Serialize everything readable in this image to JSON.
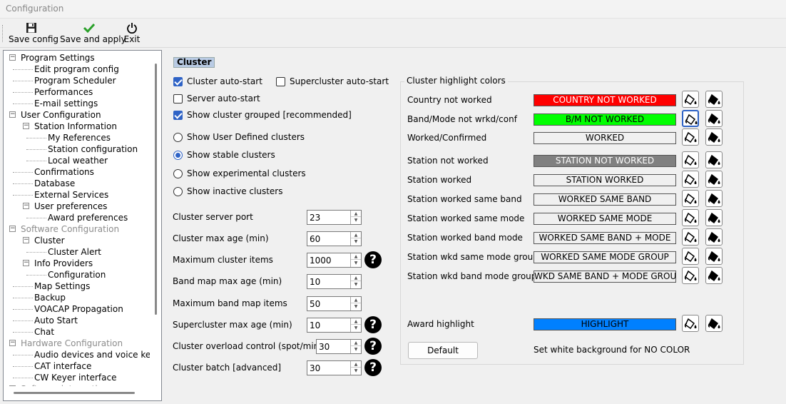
{
  "window": {
    "title": "Configuration"
  },
  "toolbar": {
    "save_config": "Save config",
    "save_apply": "Save and apply",
    "exit": "Exit"
  },
  "tree": [
    {
      "label": "Program Settings",
      "level": 0,
      "expander": "⊟",
      "disabled": false
    },
    {
      "label": "Edit program config",
      "level": 1
    },
    {
      "label": "Program Scheduler",
      "level": 1
    },
    {
      "label": "Performances",
      "level": 1
    },
    {
      "label": "E-mail settings",
      "level": 1
    },
    {
      "label": "User Configuration",
      "level": 0,
      "expander": "⊟"
    },
    {
      "label": "Station Information",
      "level": 1,
      "expander": "⊟"
    },
    {
      "label": "My References",
      "level": 2
    },
    {
      "label": "Station configuration",
      "level": 2
    },
    {
      "label": "Local weather",
      "level": 2
    },
    {
      "label": "Confirmations",
      "level": 1
    },
    {
      "label": "Database",
      "level": 1
    },
    {
      "label": "External Services",
      "level": 1
    },
    {
      "label": "User preferences",
      "level": 1,
      "expander": "⊟"
    },
    {
      "label": "Award preferences",
      "level": 2
    },
    {
      "label": "Software Configuration",
      "level": 0,
      "expander": "⊟",
      "disabled": true
    },
    {
      "label": "Cluster",
      "level": 1,
      "expander": "⊟"
    },
    {
      "label": "Cluster Alert",
      "level": 2
    },
    {
      "label": "Info Providers",
      "level": 1,
      "expander": "⊟"
    },
    {
      "label": "Configuration",
      "level": 2
    },
    {
      "label": "Map Settings",
      "level": 1
    },
    {
      "label": "Backup",
      "level": 1
    },
    {
      "label": "VOACAP Propagation",
      "level": 1
    },
    {
      "label": "Auto Start",
      "level": 1
    },
    {
      "label": "Chat",
      "level": 1
    },
    {
      "label": "Hardware Configuration",
      "level": 0,
      "expander": "⊟",
      "disabled": true
    },
    {
      "label": "Audio devices and voice keye",
      "level": 1
    },
    {
      "label": "CAT interface",
      "level": 1
    },
    {
      "label": "CW Keyer interface",
      "level": 1
    },
    {
      "label": "Software integration",
      "level": 0,
      "expander": "⊟",
      "disabled": true
    }
  ],
  "section_title": "Cluster",
  "checkboxes": {
    "cluster_autostart": {
      "label": "Cluster auto-start",
      "checked": true
    },
    "supercluster_autostart": {
      "label": "Supercluster auto-start",
      "checked": false
    },
    "server_autostart": {
      "label": "Server auto-start",
      "checked": false
    },
    "show_grouped": {
      "label": "Show cluster grouped [recommended]",
      "checked": true
    }
  },
  "radios": [
    {
      "label": "Show User Defined clusters",
      "selected": false
    },
    {
      "label": "Show stable clusters",
      "selected": true
    },
    {
      "label": "Show experimental clusters",
      "selected": false
    },
    {
      "label": "Show inactive clusters",
      "selected": false
    }
  ],
  "fields": [
    {
      "label": "Cluster server port",
      "value": "23",
      "help": false
    },
    {
      "label": "Cluster max age (min)",
      "value": "60",
      "help": false
    },
    {
      "label": "Maximum cluster items",
      "value": "1000",
      "help": true
    },
    {
      "label": "Band map max age (min)",
      "value": "10",
      "help": false
    },
    {
      "label": "Maximum band map items",
      "value": "50",
      "help": false
    },
    {
      "label": "Supercluster max age (min)",
      "value": "10",
      "help": true
    },
    {
      "label": "Cluster overload control (spot/min)",
      "value": "30",
      "help": true
    },
    {
      "label": "Cluster batch [advanced]",
      "value": "30",
      "help": true
    }
  ],
  "highlight": {
    "group_title": "Cluster highlight colors",
    "rows": [
      {
        "label": "Country not worked",
        "swatch": "COUNTRY NOT WORKED",
        "bg": "#ff0000",
        "fg": "#ffffff"
      },
      {
        "label": "Band/Mode not wrkd/conf",
        "swatch": "B/M NOT WORKED",
        "bg": "#00ff00",
        "fg": "#000000"
      },
      {
        "label": "Worked/Confirmed",
        "swatch": "WORKED",
        "bg": "#f0f0f0",
        "fg": "#000000"
      },
      {
        "label": "Station not worked",
        "swatch": "STATION NOT WORKED",
        "bg": "#808080",
        "fg": "#ffffff"
      },
      {
        "label": "Station worked",
        "swatch": "STATION WORKED",
        "bg": "#f0f0f0",
        "fg": "#000000"
      },
      {
        "label": "Station worked same band",
        "swatch": "WORKED SAME BAND",
        "bg": "#f0f0f0",
        "fg": "#000000"
      },
      {
        "label": "Station worked same mode",
        "swatch": "WORKED SAME MODE",
        "bg": "#f0f0f0",
        "fg": "#000000"
      },
      {
        "label": "Station worked band mode",
        "swatch": "WORKED SAME BAND + MODE",
        "bg": "#f0f0f0",
        "fg": "#000000"
      },
      {
        "label": "Station wkd same mode group",
        "swatch": "WORKED SAME MODE GROUP",
        "bg": "#f0f0f0",
        "fg": "#000000"
      },
      {
        "label": "Station wkd band mode group",
        "swatch": "WKD SAME BAND + MODE GROUP",
        "bg": "#f0f0f0",
        "fg": "#000000"
      }
    ],
    "award": {
      "label": "Award highlight",
      "swatch": "HIGHLIGHT",
      "bg": "#0080ff",
      "fg": "#000000"
    },
    "default_button": "Default",
    "note": "Set white background for NO COLOR"
  },
  "icons": {
    "save": "floppy-icon",
    "apply": "green-check-icon",
    "exit": "power-icon",
    "help": "question-circle-icon",
    "bg_color": "paint-bucket-bg-icon",
    "fg_color": "paint-bucket-fg-icon"
  }
}
